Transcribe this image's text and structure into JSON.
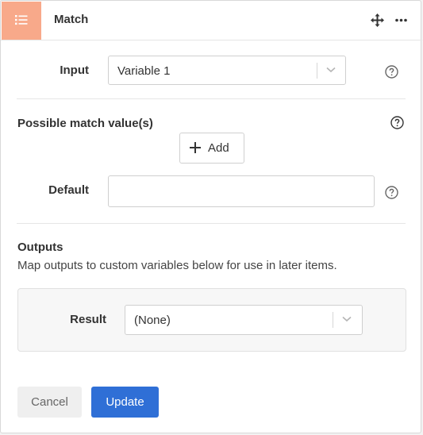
{
  "header": {
    "title": "Match",
    "icon": "list-icon",
    "icon_bg": "#f8a98a"
  },
  "input_field": {
    "label": "Input",
    "value": "Variable 1"
  },
  "match_values": {
    "title": "Possible match value(s)",
    "add_label": "Add"
  },
  "default_field": {
    "label": "Default",
    "value": ""
  },
  "outputs": {
    "title": "Outputs",
    "description": "Map outputs to custom variables below for use in later items.",
    "result_label": "Result",
    "result_value": "(None)"
  },
  "footer": {
    "cancel_label": "Cancel",
    "update_label": "Update",
    "update_color": "#2f6fd6"
  }
}
